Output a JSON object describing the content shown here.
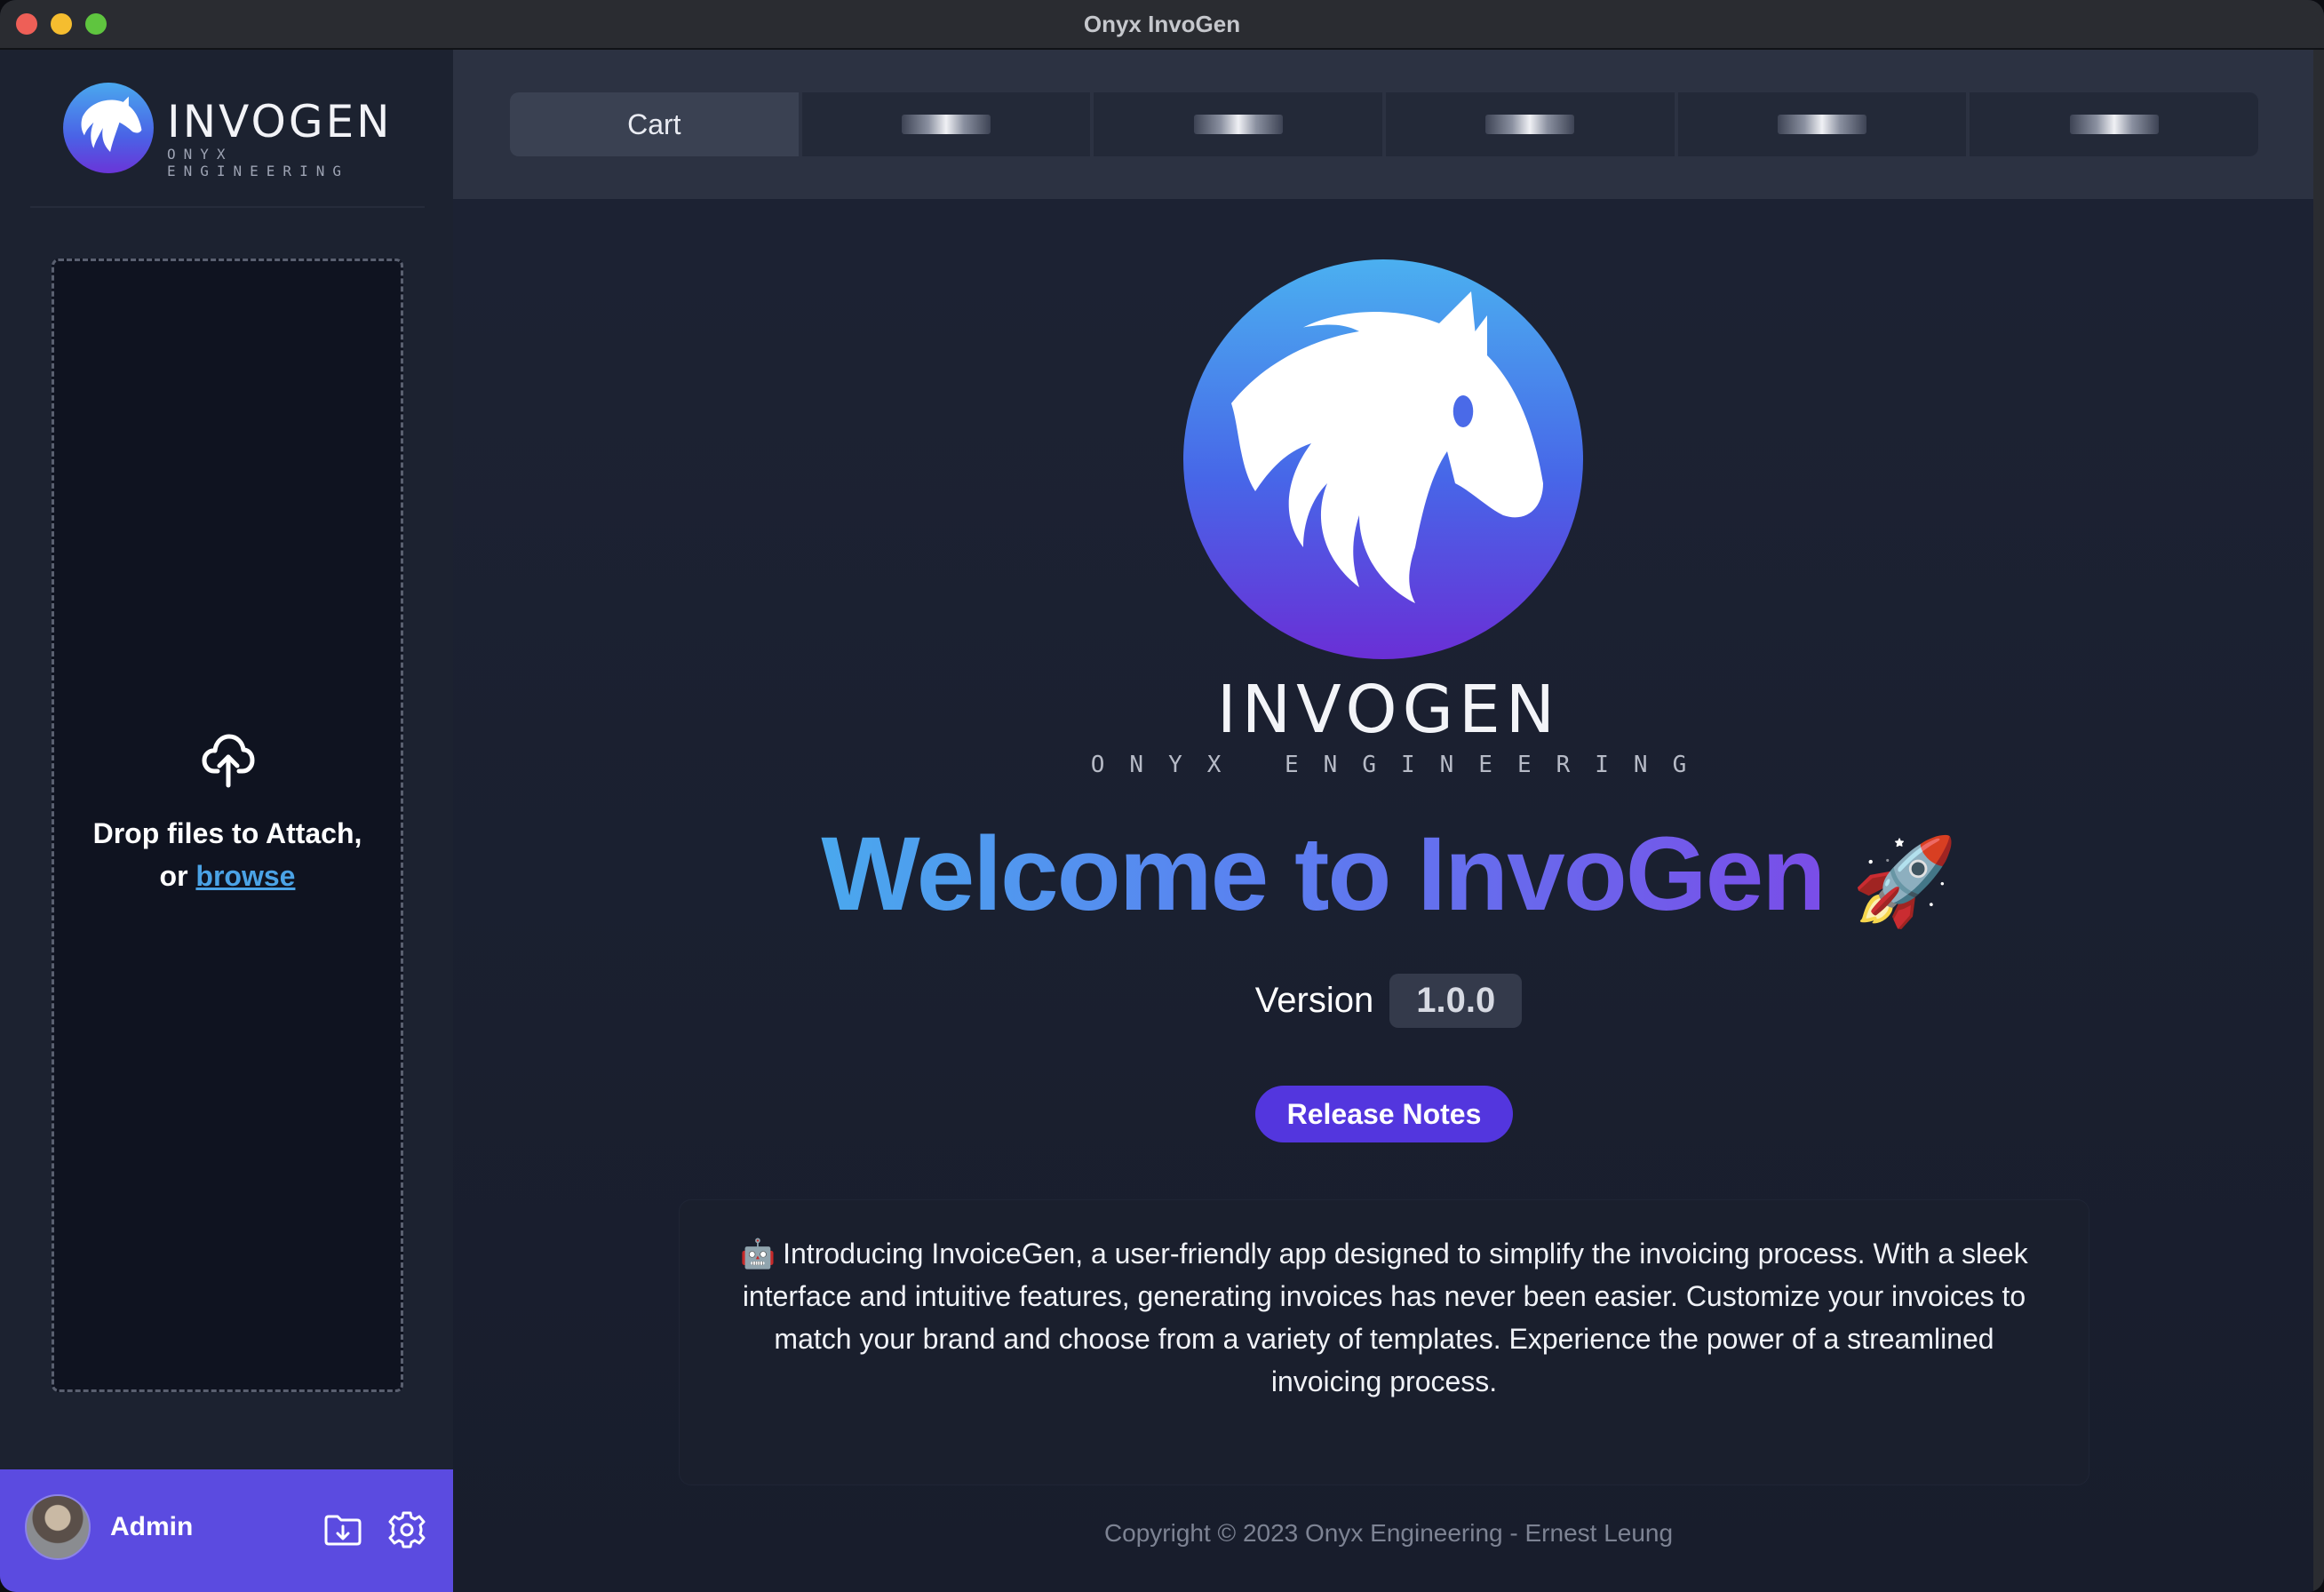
{
  "window": {
    "title": "Onyx InvoGen"
  },
  "sidebar": {
    "logo": {
      "word": "INVOGEN",
      "sub": "ONYX ENGINEERING"
    },
    "dropzone": {
      "text": "Drop files to Attach,",
      "or": "or",
      "browse": "browse"
    },
    "user": {
      "name": "Admin"
    }
  },
  "tabs": [
    {
      "label": "Cart"
    },
    {
      "label": ""
    },
    {
      "label": ""
    },
    {
      "label": ""
    },
    {
      "label": ""
    },
    {
      "label": ""
    }
  ],
  "hero": {
    "word": "INVOGEN",
    "sub": "ONYX ENGINEERING",
    "welcome": "Welcome to InvoGen",
    "rocket": "🚀",
    "version_label": "Version",
    "version": "1.0.0",
    "release_button": "Release Notes",
    "emoji": "🤖",
    "description": "Introducing InvoiceGen, a user-friendly app designed to simplify the invoicing process. With a sleek interface and intuitive features, generating invoices has never been easier. Customize your invoices to match your brand and choose from a variety of templates. Experience the power of a streamlined invoicing process.",
    "copyright": "Copyright © 2023 Onyx Engineering - Ernest Leung"
  },
  "colors": {
    "accent": "#5336de",
    "userbar": "#5b4be0",
    "link": "#4ba3e6",
    "gradient_start": "#4aa8ee",
    "gradient_end": "#7a4de8"
  },
  "icons": [
    "horse-logo-icon",
    "upload-cloud-icon",
    "folder-download-icon",
    "gear-icon"
  ]
}
